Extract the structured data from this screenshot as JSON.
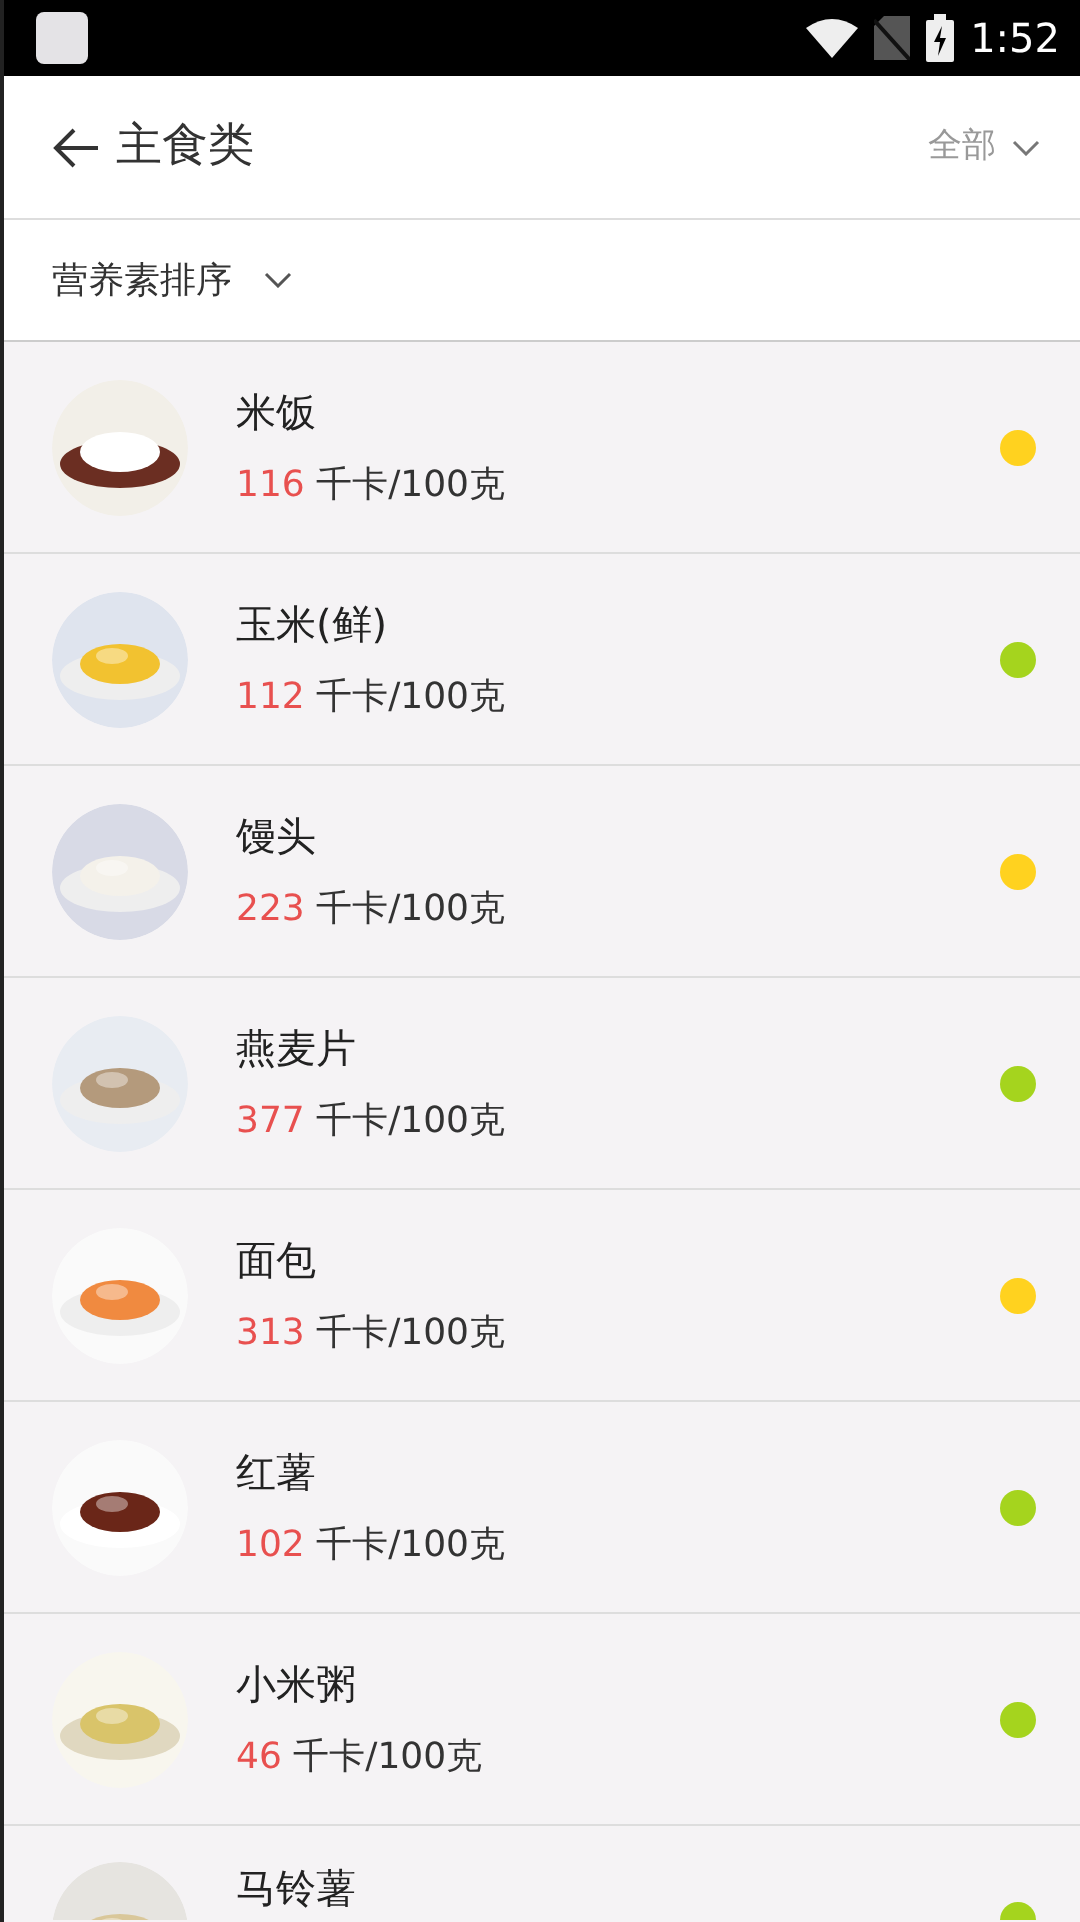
{
  "status_bar": {
    "time": "1:52"
  },
  "header": {
    "title": "主食类",
    "filter": "全部"
  },
  "sort": {
    "label": "营养素排序"
  },
  "foods": [
    {
      "name": "米饭",
      "kcal": "116",
      "unit": "千卡/100克",
      "color": "#ffd21f"
    },
    {
      "name": "玉米(鲜)",
      "kcal": "112",
      "unit": "千卡/100克",
      "color": "#a5d41e"
    },
    {
      "name": "馒头",
      "kcal": "223",
      "unit": "千卡/100克",
      "color": "#ffd21f"
    },
    {
      "name": "燕麦片",
      "kcal": "377",
      "unit": "千卡/100克",
      "color": "#a5d41e"
    },
    {
      "name": "面包",
      "kcal": "313",
      "unit": "千卡/100克",
      "color": "#ffd21f"
    },
    {
      "name": "红薯",
      "kcal": "102",
      "unit": "千卡/100克",
      "color": "#a5d41e"
    },
    {
      "name": "小米粥",
      "kcal": "46",
      "unit": "千卡/100克",
      "color": "#a5d41e"
    },
    {
      "name": "马铃薯",
      "color": "#a5d41e"
    }
  ]
}
